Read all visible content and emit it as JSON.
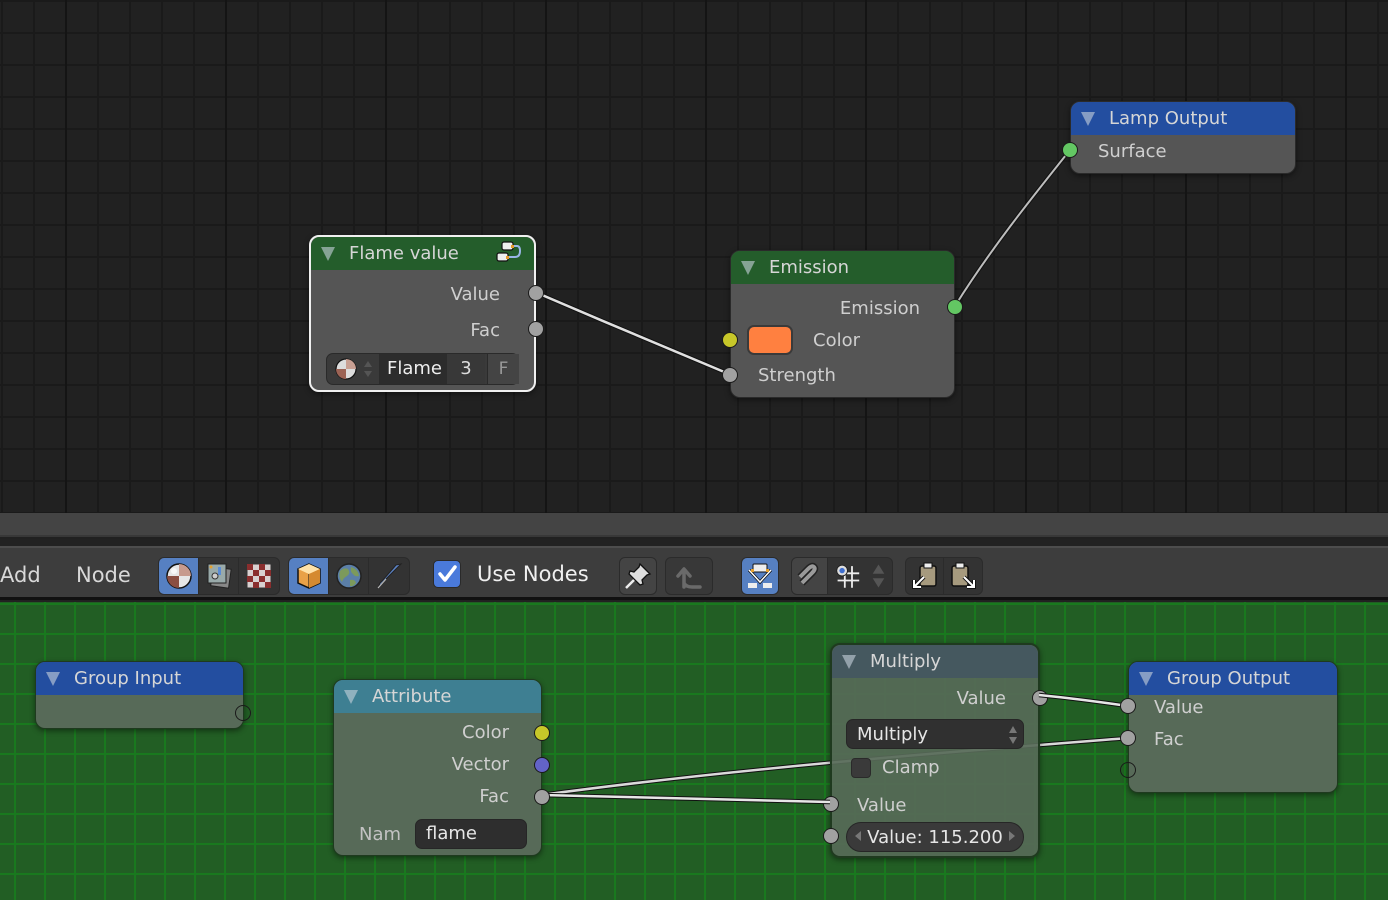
{
  "top_editor": {
    "nodes": {
      "flame_value": {
        "title": "Flame value",
        "outputs": [
          "Value",
          "Fac"
        ],
        "group_selector": {
          "name": "Flame",
          "users": "3",
          "fake_user": "F"
        }
      },
      "emission": {
        "title": "Emission",
        "outputs": [
          "Emission"
        ],
        "inputs": [
          "Color",
          "Strength"
        ],
        "color_value": "#ff8040"
      },
      "lamp_output": {
        "title": "Lamp Output",
        "inputs": [
          "Surface"
        ]
      }
    },
    "links": [
      {
        "from": "Flame value.Value",
        "to": "Emission.Strength"
      },
      {
        "from": "Emission.Emission",
        "to": "Lamp Output.Surface"
      }
    ]
  },
  "header": {
    "menus": [
      "Add",
      "Node"
    ],
    "tree_type_buttons": [
      {
        "icon": "material-icon",
        "active": true
      },
      {
        "icon": "compositing-icon",
        "active": false
      },
      {
        "icon": "texture-icon",
        "active": false
      }
    ],
    "shader_type_buttons": [
      {
        "icon": "object-icon",
        "active": true
      },
      {
        "icon": "world-icon",
        "active": false
      },
      {
        "icon": "line-style-icon",
        "active": false
      }
    ],
    "use_nodes": {
      "label": "Use Nodes",
      "checked": true
    },
    "pin_icon": "pin-icon",
    "parent_icon": "go-to-parent-icon",
    "backdrop_icon": "backdrop-icon",
    "snap_icon": "snap-magnet-icon",
    "snap_element_icon": "snap-grid-icon",
    "copy_icon": "copy-to-clipboard-icon",
    "paste_icon": "paste-from-clipboard-icon"
  },
  "bottom_editor": {
    "nodes": {
      "group_input": {
        "title": "Group Input"
      },
      "attribute": {
        "title": "Attribute",
        "outputs": [
          "Color",
          "Vector",
          "Fac"
        ],
        "name_label": "Nam",
        "name_value": "flame"
      },
      "multiply": {
        "title": "Multiply",
        "outputs": [
          "Value"
        ],
        "operation": "Multiply",
        "clamp_label": "Clamp",
        "clamp_checked": false,
        "inputs": [
          "Value"
        ],
        "value_field": "Value: 115.200"
      },
      "group_output": {
        "title": "Group Output",
        "inputs": [
          "Value",
          "Fac"
        ]
      }
    },
    "links": [
      {
        "from": "Attribute.Fac",
        "to": "Multiply.Value"
      },
      {
        "from": "Attribute.Fac",
        "to": "Group Output.Fac"
      },
      {
        "from": "Multiply.Value",
        "to": "Group Output.Value"
      }
    ]
  },
  "colors": {
    "top_bg": "#212121",
    "bottom_bg": "#225e24",
    "shader_header": "#245d2b",
    "output_header": "#234ea0",
    "input_header": "#3e7f92",
    "converter_header": "#45585f",
    "accent": "#5680c2"
  }
}
